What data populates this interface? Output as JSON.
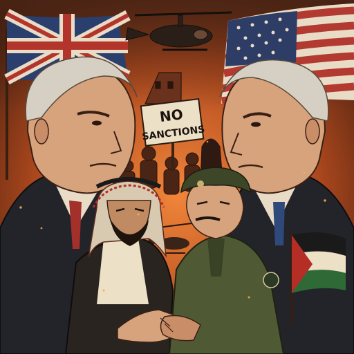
{
  "protest_sign": {
    "line1": "NO",
    "line2": "SANCTIONS"
  },
  "colors": {
    "sky_glow": "#e06a2a",
    "sky_dark": "#3a1a0e",
    "fire": "#f08a3a",
    "uk_blue": "#2b3f6e",
    "uk_red": "#b3342a",
    "us_red": "#b23a30",
    "us_blue": "#2e3d66",
    "suit_dark": "#23232a",
    "uniform_olive": "#4f5a34",
    "skin": "#d7a37c",
    "palestine_green": "#2f6a36",
    "palestine_red": "#b52e26"
  }
}
